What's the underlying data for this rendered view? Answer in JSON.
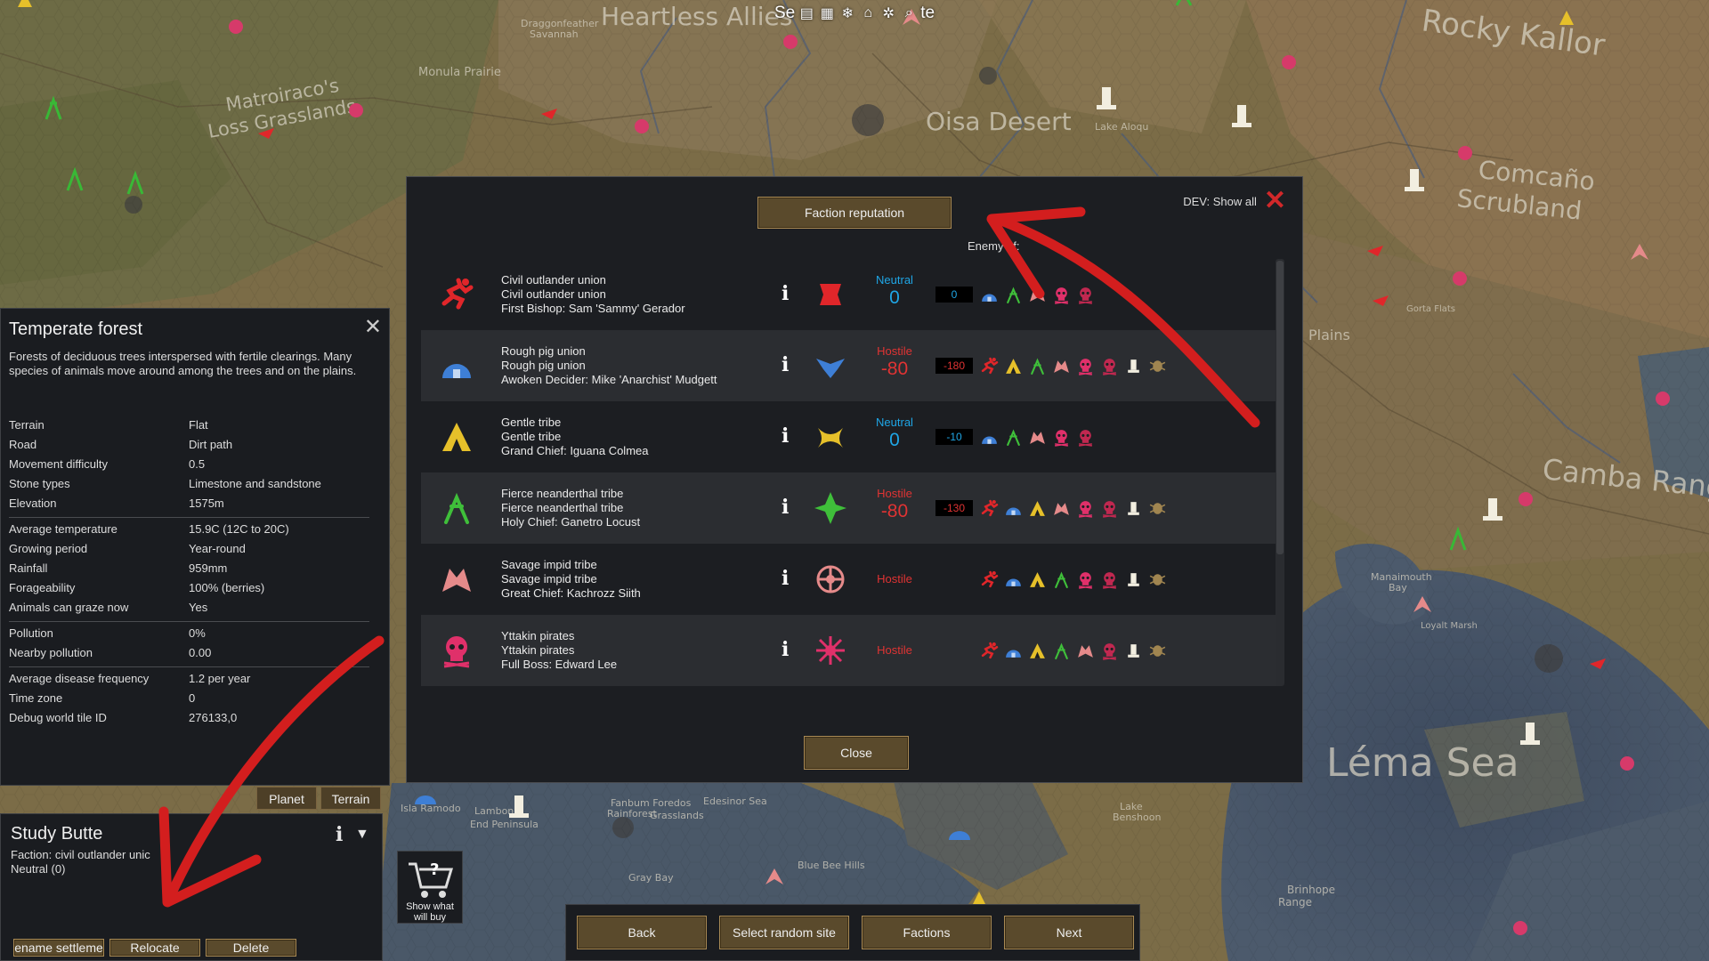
{
  "map": {
    "labels": [
      "Heartless Allies",
      "Rocky Kallor",
      "Oisa Desert",
      "Matroiraco's Loss Grasslands",
      "Monula Prairie",
      "Draggonfeather Savannah",
      "Lake Aloqu",
      "Comcaño Scrubland",
      "Camba Range",
      "Léma Sea",
      "Plains",
      "Manaimouth Bay",
      "Isla Ramodo",
      "Fanbum Foredos Rainforest",
      "Edesinor Sea",
      "Grasslands",
      "Gray Bay",
      "Blue Bee Hills",
      "Lake Benshoon",
      "Brinhope Range",
      "Gorta Flats",
      "Loyalt Marsh",
      "Lambon End Peninsula"
    ]
  },
  "topbar": {
    "text": "Se",
    "text_after": "te"
  },
  "dialog": {
    "faction_reputation_label": "Faction reputation",
    "dev_show_all": "DEV: Show all",
    "enemy_of_label": "Enemy of:",
    "close_label": "Close",
    "factions": [
      {
        "icon": "runner-icon",
        "color": "#e0262a",
        "lines": [
          "Civil outlander union",
          "Civil outlander union",
          "First Bishop: Sam 'Sammy' Gerador"
        ],
        "info": "i",
        "ideo": "red-diamond-icon",
        "relation": "Neutral",
        "relation_class": "neutral",
        "goodwill": "0",
        "natural_goodwill": "0",
        "enemies": [
          "dome",
          "neanderthal",
          "impid",
          "pirate",
          "pirate2"
        ]
      },
      {
        "icon": "dome-icon",
        "color": "#3e7fd6",
        "lines": [
          "Rough pig union",
          "Rough pig union",
          "Awoken Decider: Mike 'Anarchist' Mudgett"
        ],
        "info": "i",
        "ideo": "blue-winged-icon",
        "relation": "Hostile",
        "relation_class": "hostile",
        "goodwill": "-80",
        "natural_goodwill": "-180",
        "enemies": [
          "runner",
          "tent",
          "neanderthal",
          "impid",
          "pirate",
          "pirate2",
          "mech",
          "insect"
        ]
      },
      {
        "icon": "tent-icon",
        "color": "#e6c02a",
        "lines": [
          "Gentle tribe",
          "Gentle tribe",
          "Grand Chief: Iguana Colmea"
        ],
        "info": "i",
        "ideo": "gold-crescent-icon",
        "relation": "Neutral",
        "relation_class": "neutral",
        "goodwill": "0",
        "natural_goodwill": "-10",
        "enemies": [
          "dome",
          "neanderthal",
          "impid",
          "pirate",
          "pirate2"
        ]
      },
      {
        "icon": "neanderthal-icon",
        "color": "#3fbf3a",
        "lines": [
          "Fierce neanderthal tribe",
          "Fierce neanderthal tribe",
          "Holy Chief: Ganetro Locust"
        ],
        "info": "i",
        "ideo": "green-star-icon",
        "relation": "Hostile",
        "relation_class": "hostile",
        "goodwill": "-80",
        "natural_goodwill": "-130",
        "enemies": [
          "runner",
          "dome",
          "tent",
          "impid",
          "pirate",
          "pirate2",
          "mech",
          "insect"
        ]
      },
      {
        "icon": "impid-icon",
        "color": "#e58a8a",
        "lines": [
          "Savage impid tribe",
          "Savage impid tribe",
          "Great Chief: Kachrozz Siith"
        ],
        "info": "i",
        "ideo": "red-circle-icon",
        "relation": "Hostile",
        "relation_class": "hostile",
        "goodwill": "",
        "natural_goodwill": "",
        "enemies": [
          "runner",
          "dome",
          "tent",
          "neanderthal",
          "pirate",
          "pirate2",
          "mech",
          "insect"
        ]
      },
      {
        "icon": "pirate-icon",
        "color": "#e0306a",
        "lines": [
          "Yttakin pirates",
          "Yttakin pirates",
          "Full Boss: Edward Lee"
        ],
        "info": "i",
        "ideo": "red-splat-icon",
        "relation": "Hostile",
        "relation_class": "hostile",
        "goodwill": "",
        "natural_goodwill": "",
        "enemies": [
          "runner",
          "dome",
          "tent",
          "neanderthal",
          "impid",
          "pirate2",
          "mech",
          "insect"
        ]
      }
    ]
  },
  "inspect": {
    "title": "Temperate forest",
    "description": "Forests of deciduous trees interspersed with fertile clearings. Many species of animals move around among the trees and on the plains.",
    "groups": [
      [
        [
          "Terrain",
          "Flat"
        ],
        [
          "Road",
          "Dirt path"
        ],
        [
          "Movement difficulty",
          "0.5"
        ],
        [
          "Stone types",
          "Limestone and sandstone"
        ],
        [
          "Elevation",
          "1575m"
        ]
      ],
      [
        [
          "Average temperature",
          "15.9C (12C to 20C)"
        ],
        [
          "Growing period",
          "Year-round"
        ],
        [
          "Rainfall",
          "959mm"
        ],
        [
          "Forageability",
          "100% (berries)"
        ],
        [
          "Animals can graze now",
          "Yes"
        ]
      ],
      [
        [
          "Pollution",
          "0%"
        ],
        [
          "Nearby pollution",
          "0.00"
        ]
      ],
      [
        [
          "Average disease frequency",
          "1.2 per year"
        ],
        [
          "Time zone",
          "0"
        ],
        [
          "Debug world tile ID",
          "276133,0"
        ]
      ]
    ],
    "tabs": [
      "Planet",
      "Terrain"
    ]
  },
  "settlement": {
    "name": "Study Butte",
    "faction": "Faction: civil outlander unic",
    "relation": "Neutral (0)",
    "info": "i",
    "buttons": [
      "ename settleme",
      "Relocate",
      "Delete"
    ]
  },
  "shop": {
    "label1": "Show what",
    "label2": "will buy"
  },
  "bottom": {
    "back": "Back",
    "random": "Select random site",
    "factions": "Factions",
    "next": "Next"
  },
  "colors": {
    "annotation_red": "#d31e1e",
    "button_brown": "#5a4a2c",
    "panel_dark": "#1c1e22"
  }
}
